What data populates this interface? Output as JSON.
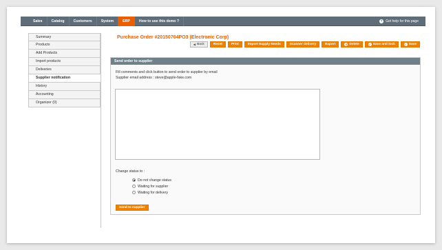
{
  "topnav": {
    "menu": [
      "Sales",
      "Catalog",
      "Customers",
      "System",
      "ERP",
      "How to use this demo ?"
    ],
    "active": "ERP",
    "help_label": "Get help for this page"
  },
  "sidebar": {
    "items": [
      "Summary",
      "Products",
      "Add Products",
      "Import products",
      "Deliveries",
      "Supplier notification",
      "History",
      "Accounting",
      "Organizer (0)"
    ],
    "active": "Supplier notification"
  },
  "page_title": "Purchase Order #20150704PO3 (Electronic Corp)",
  "toolbar": {
    "back": "Back",
    "reset": "Reset",
    "print": "Print",
    "import_supply_needs": "Import Supply Needs",
    "scanner_delivery": "Scanner delivery",
    "export": "Export",
    "delete": "Delete",
    "save_and_lock": "Save and lock",
    "save": "Save"
  },
  "panel": {
    "title": "Send order to supplier",
    "instructions": "Fill comments and click button to send order to supplier by email",
    "supplier_email": "Supplier email address : steve@apple-fake.com",
    "comment_value": "",
    "change_status_label": "Change status to :",
    "status_options": [
      "Do not change status",
      "Waiting for supplier",
      "Waiting for delivery"
    ],
    "selected_status": "Do not change status",
    "send_button": "Send to supplier"
  },
  "colors": {
    "accent": "#eb5e00",
    "button": "#f18200",
    "nav_bg": "#5f6d78",
    "panel_head": "#6f8089"
  }
}
